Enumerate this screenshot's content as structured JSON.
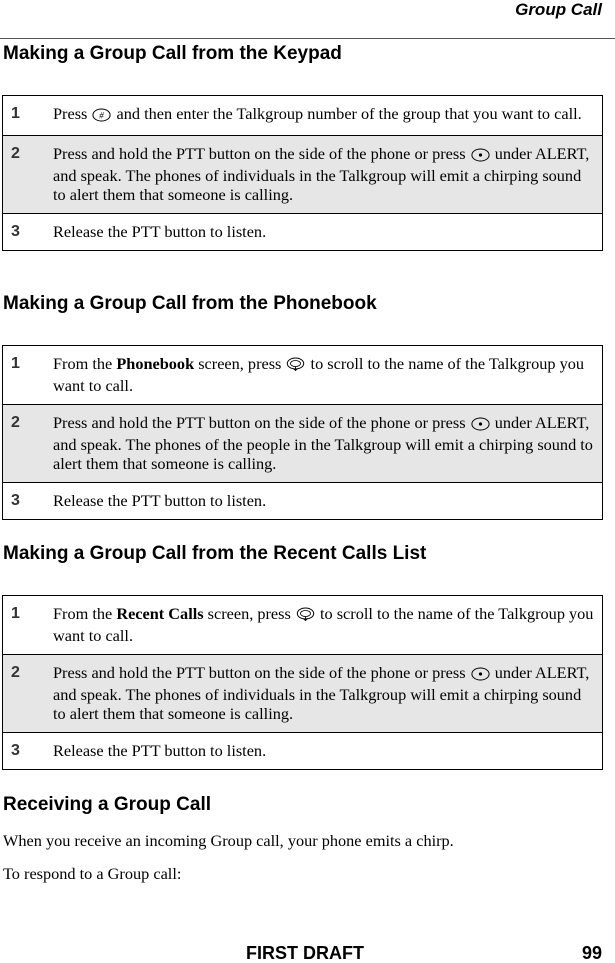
{
  "header": {
    "running_title": "Group Call"
  },
  "sections": [
    {
      "heading": "Making a Group Call from the Keypad",
      "steps": [
        {
          "num": "1",
          "pre": "Press ",
          "icon": "pound-key-icon",
          "post": " and then enter the Talkgroup number of the group that you want to call."
        },
        {
          "num": "2",
          "pre": "Press and hold the PTT button on the side of the phone or press ",
          "icon": "center-select-key-icon",
          "post": " under ALERT, and speak. The phones of individuals in the Talkgroup will emit a chirping sound to alert them that someone is calling."
        },
        {
          "num": "3",
          "text": "Release the PTT button to listen."
        }
      ]
    },
    {
      "heading": "Making a Group Call from the Phonebook",
      "steps": [
        {
          "num": "1",
          "pre": "From the ",
          "bold": "Phonebook",
          "mid": " screen, press ",
          "icon": "navigation-key-icon",
          "post": " to scroll to the name of the Talkgroup you want to call."
        },
        {
          "num": "2",
          "pre": "Press and hold the PTT button on the side of the phone or press ",
          "icon": "center-select-key-icon",
          "post": " under ALERT, and speak. The phones of the people in the Talkgroup will emit a chirping sound to alert them that someone is calling."
        },
        {
          "num": "3",
          "text": "Release the PTT button to listen."
        }
      ]
    },
    {
      "heading": "Making a Group Call from the Recent Calls List",
      "steps": [
        {
          "num": "1",
          "pre": "From the ",
          "bold": "Recent Calls",
          "mid": " screen, press ",
          "icon": "navigation-key-icon",
          "post": " to scroll to the name of the Talkgroup you want to call."
        },
        {
          "num": "2",
          "pre": "Press and hold the PTT button on the side of the phone or press ",
          "icon": "center-select-key-icon",
          "post": " under ALERT, and speak. The phones of individuals in the Talkgroup will emit a chirping sound to alert them that someone is calling."
        },
        {
          "num": "3",
          "text": "Release the PTT button to listen."
        }
      ]
    },
    {
      "heading": "Receiving a Group Call",
      "paragraphs": [
        "When you receive an incoming Group call, your phone emits a chirp.",
        "To respond to a Group call:"
      ]
    }
  ],
  "footer": {
    "draft_label": "FIRST DRAFT",
    "page_number": "99"
  }
}
